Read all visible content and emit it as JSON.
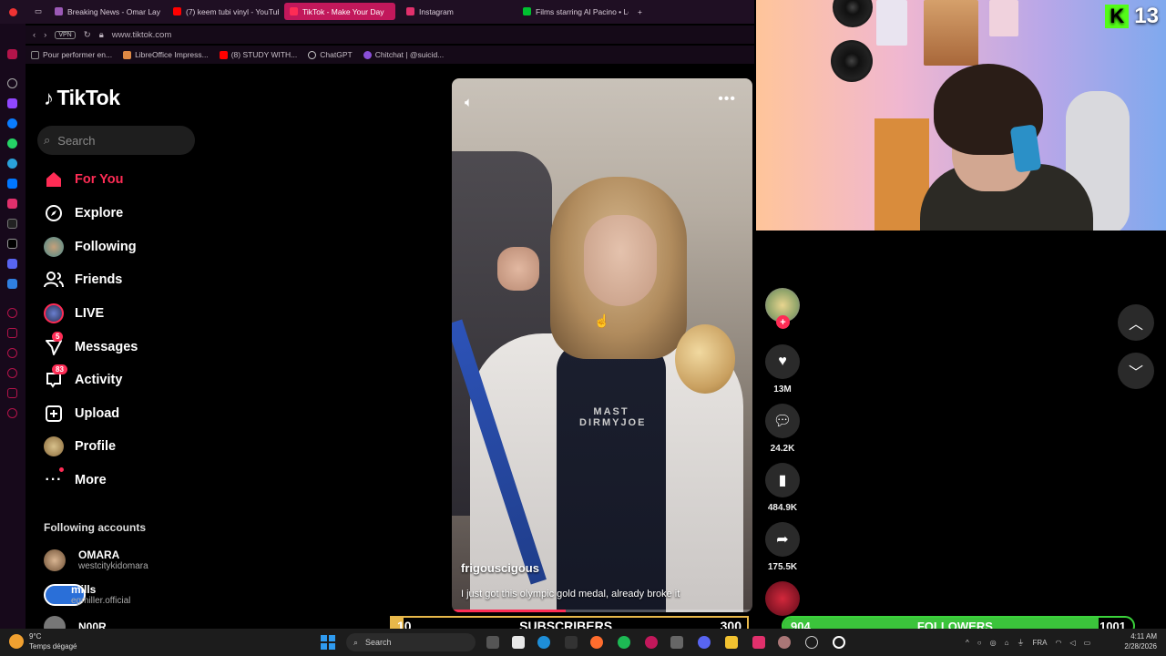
{
  "browser": {
    "tabs": [
      {
        "label": "Breaking News - Omar Lay",
        "color": "#9b59b6",
        "active": false
      },
      {
        "label": "(7) keem tubi vinyl - YouTube",
        "color": "#ff0000",
        "active": false
      },
      {
        "label": "TikTok - Make Your Day",
        "color": "#fe2c55",
        "active": true
      },
      {
        "label": "Instagram",
        "color": "#e1306c",
        "active": false
      },
      {
        "label": "Films starring Al Pacino • Letterboxd",
        "color": "#00c030",
        "active": false
      }
    ],
    "url": "www.tiktok.com",
    "vpn_label": "VPN",
    "bookmarks": [
      "Pour performer en...",
      "LibreOffice Impress...",
      "(8) STUDY WITH...",
      "ChatGPT",
      "Chitchat | @suicid..."
    ]
  },
  "tiktok": {
    "brand": "TikTok",
    "search_placeholder": "Search",
    "nav": [
      {
        "label": "For You",
        "icon": "home-icon",
        "active": true
      },
      {
        "label": "Explore",
        "icon": "compass-icon"
      },
      {
        "label": "Following",
        "icon": "following-avatar-icon"
      },
      {
        "label": "Friends",
        "icon": "friends-icon"
      },
      {
        "label": "LIVE",
        "icon": "live-icon"
      },
      {
        "label": "Messages",
        "icon": "messages-icon",
        "badge": "5"
      },
      {
        "label": "Activity",
        "icon": "activity-icon",
        "badge": "83"
      },
      {
        "label": "Upload",
        "icon": "upload-icon"
      },
      {
        "label": "Profile",
        "icon": "profile-avatar-icon"
      },
      {
        "label": "More",
        "icon": "more-icon"
      }
    ],
    "following_header": "Following accounts",
    "accounts": [
      {
        "name": "OMARA",
        "handle": "westcitykidomara"
      },
      {
        "name": "mills",
        "handle": "egmiller.official"
      },
      {
        "name": "N00R",
        "handle": ""
      }
    ]
  },
  "video": {
    "author": "frigouscigous",
    "description": "I just got this olympic gold medal, already broke it",
    "shirt_text": "MAST DIRMYJOE",
    "progress": 0.38
  },
  "actions": {
    "likes": "13M",
    "comments": "24.2K",
    "saves": "484.9K",
    "shares": "175.5K"
  },
  "stream": {
    "kick_count": "13",
    "subs_current": "10",
    "subs_label": "SUBSCRIBERS",
    "subs_goal": "300",
    "subs_progress": 0.033,
    "followers_current": "904",
    "followers_label": "FOLLOWERS",
    "followers_goal": "1001",
    "followers_progress": 0.9
  },
  "taskbar": {
    "temp": "9°C",
    "weather": "Temps dégagé",
    "search": "Search",
    "lang": "FRA",
    "time": "4:11 AM",
    "date": "2/28/2026"
  },
  "colors": {
    "tiktok_red": "#fe2c55",
    "kick_green": "#53fc18",
    "sub_gold": "#e8b84a",
    "follow_green": "#3bc43b"
  }
}
